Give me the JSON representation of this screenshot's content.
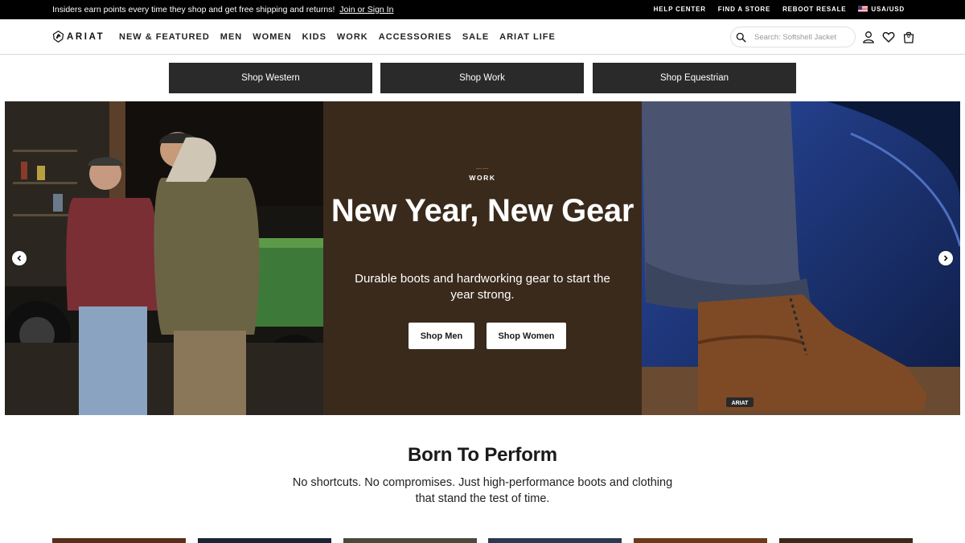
{
  "promo": {
    "text": "Insiders earn points every time they shop and get free shipping and returns!",
    "link": "Join or Sign In"
  },
  "utility_links": [
    "HELP CENTER",
    "FIND A STORE",
    "REBOOT RESALE",
    "USA/USD"
  ],
  "brand": {
    "logo_text": "ARIAT"
  },
  "nav": [
    "NEW & FEATURED",
    "MEN",
    "WOMEN",
    "KIDS",
    "WORK",
    "ACCESSORIES",
    "SALE",
    "ARIAT LIFE"
  ],
  "search": {
    "placeholder": "Search: Softshell Jacket"
  },
  "header_icons": [
    "account-icon",
    "heart-icon",
    "bag-icon"
  ],
  "cart_count": "0",
  "shop_buttons": [
    "Shop Western",
    "Shop Work",
    "Shop Equestrian"
  ],
  "hero": {
    "eyebrow": "WORK",
    "headline": "New Year, New Gear",
    "subhead": "Durable boots and hardworking gear to start the year strong.",
    "cta_men": "Shop Men",
    "cta_women": "Shop Women",
    "boot_badge": "ARIAT",
    "prev_icon": "chevron-left-icon",
    "next_icon": "chevron-right-icon"
  },
  "section": {
    "title": "Born To Perform",
    "subtitle": "No shortcuts. No compromises. Just high-performance boots and clothing that stand the test of time."
  },
  "colors": {
    "promo_bg": "#000000",
    "shop_button_bg": "#2a2a2a",
    "hero_panel_bg": "#3a2a1c",
    "accent": "#c97a2a"
  }
}
